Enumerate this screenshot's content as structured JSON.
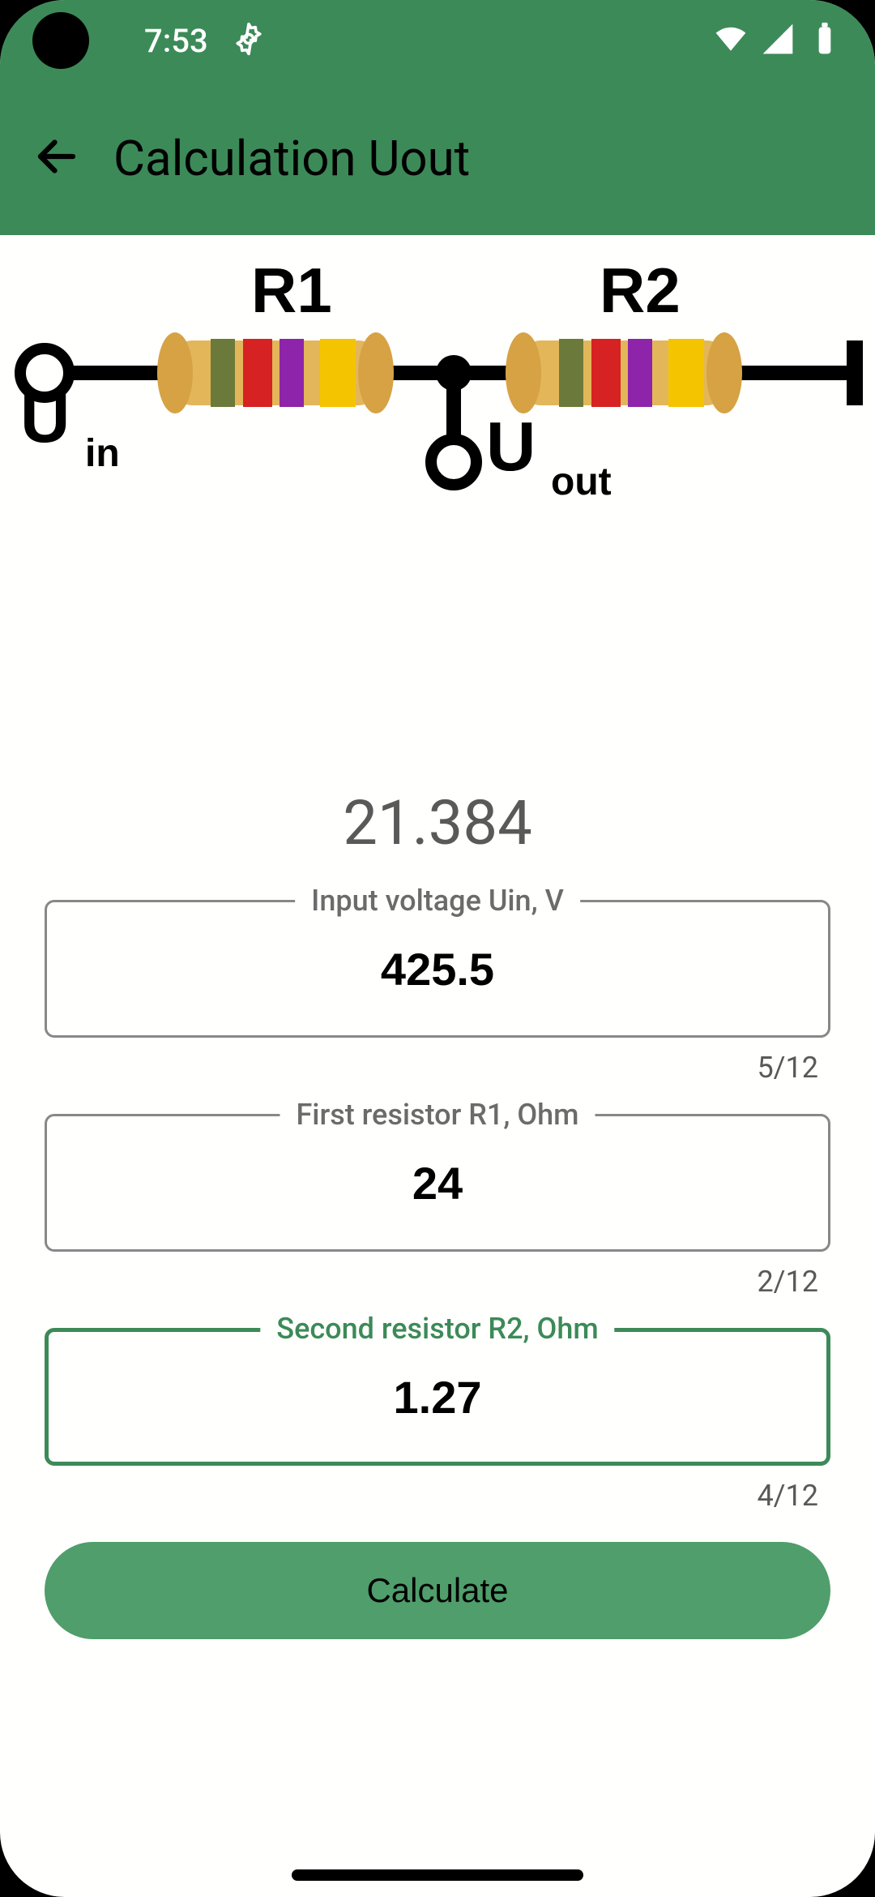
{
  "statusbar": {
    "time": "7:53"
  },
  "appbar": {
    "title": "Calculation Uout"
  },
  "diagram": {
    "r1_label": "R1",
    "r2_label": "R2",
    "uin_u": "U",
    "uin_sub": "in",
    "uout_u": "U",
    "uout_sub": "out"
  },
  "result": "21.384",
  "fields": {
    "uin": {
      "label": "Input voltage Uin, V",
      "value": "425.5",
      "counter": "5/12"
    },
    "r1": {
      "label": "First resistor R1, Ohm",
      "value": "24",
      "counter": "2/12"
    },
    "r2": {
      "label": "Second resistor R2, Ohm",
      "value": "1.27",
      "counter": "4/12"
    }
  },
  "button": {
    "calculate": "Calculate"
  }
}
